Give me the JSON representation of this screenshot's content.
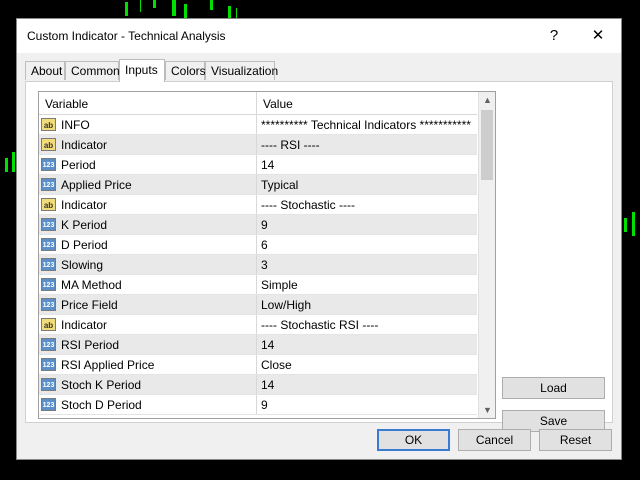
{
  "dialog": {
    "title": "Custom Indicator - Technical Analysis",
    "help_label": "?",
    "close_label": "✕"
  },
  "tabs": [
    {
      "label": "About"
    },
    {
      "label": "Common"
    },
    {
      "label": "Inputs"
    },
    {
      "label": "Colors"
    },
    {
      "label": "Visualization"
    }
  ],
  "active_tab": "Inputs",
  "grid": {
    "headers": {
      "variable": "Variable",
      "value": "Value"
    },
    "rows": [
      {
        "icon": "ab",
        "variable": "INFO",
        "value": "********** Technical Indicators ***********"
      },
      {
        "icon": "ab",
        "variable": "Indicator",
        "value": "---- RSI ----"
      },
      {
        "icon": "123",
        "variable": "Period",
        "value": "14"
      },
      {
        "icon": "123",
        "variable": "Applied Price",
        "value": "Typical"
      },
      {
        "icon": "ab",
        "variable": "Indicator",
        "value": "---- Stochastic ----"
      },
      {
        "icon": "123",
        "variable": "K Period",
        "value": "9"
      },
      {
        "icon": "123",
        "variable": "D Period",
        "value": "6"
      },
      {
        "icon": "123",
        "variable": "Slowing",
        "value": "3"
      },
      {
        "icon": "123",
        "variable": "MA Method",
        "value": "Simple"
      },
      {
        "icon": "123",
        "variable": "Price Field",
        "value": "Low/High"
      },
      {
        "icon": "ab",
        "variable": "Indicator",
        "value": "---- Stochastic RSI ----"
      },
      {
        "icon": "123",
        "variable": "RSI Period",
        "value": "14"
      },
      {
        "icon": "123",
        "variable": "RSI Applied Price",
        "value": "Close"
      },
      {
        "icon": "123",
        "variable": "Stoch K Period",
        "value": "14"
      },
      {
        "icon": "123",
        "variable": "Stoch D Period",
        "value": "9"
      }
    ]
  },
  "side_buttons": {
    "load": "Load",
    "save": "Save"
  },
  "footer_buttons": {
    "ok": "OK",
    "cancel": "Cancel",
    "reset": "Reset"
  },
  "colors": {
    "background": "#000000",
    "candle": "#00e000",
    "default_button_border": "#3b7bd4"
  }
}
